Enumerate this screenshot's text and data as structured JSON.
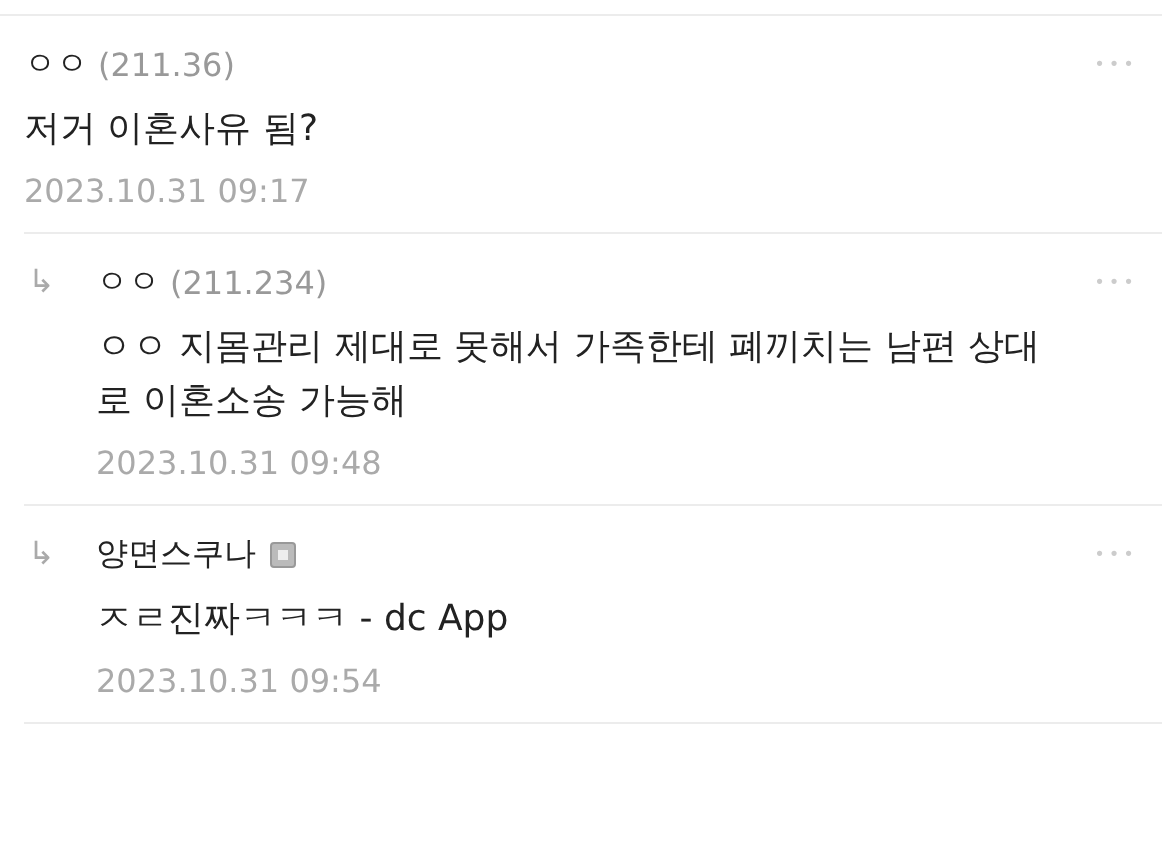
{
  "comments": [
    {
      "kind": "comment",
      "author": "ㅇㅇ",
      "ip": "(211.36)",
      "badge": false,
      "text": "저거 이혼사유 됨?",
      "date": "2023.10.31 09:17",
      "more": "•••"
    },
    {
      "kind": "reply",
      "arrow": "↳",
      "author": "ㅇㅇ",
      "ip": "(211.234)",
      "badge": false,
      "text": "ㅇㅇ 지몸관리 제대로 못해서 가족한테 폐끼치는 남편 상대로 이혼소송 가능해",
      "date": "2023.10.31 09:48",
      "more": "•••"
    },
    {
      "kind": "reply",
      "arrow": "↳",
      "author": "양면스쿠나",
      "badge": true,
      "text": "ㅈㄹ진짜ㅋㅋㅋ - dc App",
      "date": "2023.10.31 09:54",
      "more": "•••"
    }
  ]
}
